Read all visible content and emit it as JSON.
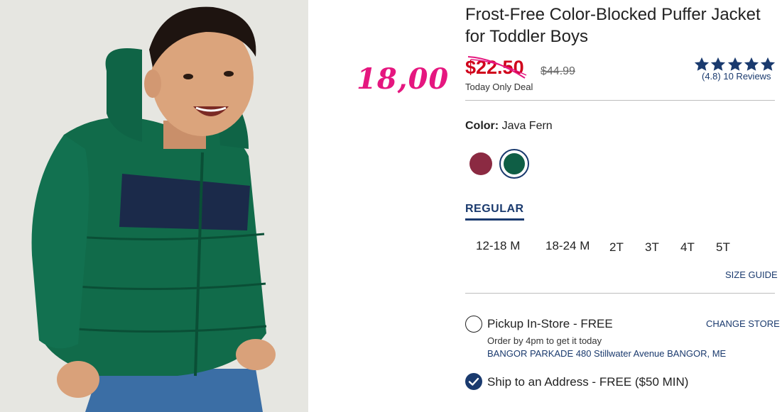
{
  "product": {
    "title": "Frost-Free Color-Blocked Puffer Jacket for Toddler Boys",
    "sale_price": "$22.50",
    "original_price": "$44.99",
    "deal_label": "Today Only Deal",
    "overlay_price": "18,00",
    "rating": {
      "stars": 5,
      "text": "(4.8)",
      "reviews": "10 Reviews",
      "color": "#1a3a6e"
    }
  },
  "color": {
    "label": "Color:",
    "value": "Java Fern",
    "swatches": [
      {
        "name": "burgundy",
        "hex": "#8b2a42",
        "selected": false
      },
      {
        "name": "java-fern",
        "hex": "#0f5e45",
        "selected": true
      }
    ]
  },
  "fit": {
    "tab": "REGULAR"
  },
  "sizes": [
    "12-18 M",
    "18-24 M",
    "2T",
    "3T",
    "4T",
    "5T"
  ],
  "size_guide": "SIZE GUIDE",
  "fulfillment": {
    "pickup_label": "Pickup In-Store - FREE",
    "change_store": "CHANGE STORE",
    "order_by": "Order by 4pm to get it today",
    "store_address": "BANGOR PARKADE 480 Stillwater Avenue  BANGOR, ME",
    "ship_label": "Ship to an Address - FREE ($50 MIN)"
  },
  "colors": {
    "accent": "#1a3a6e",
    "sale": "#d0021b",
    "overlay": "#e5177f"
  }
}
